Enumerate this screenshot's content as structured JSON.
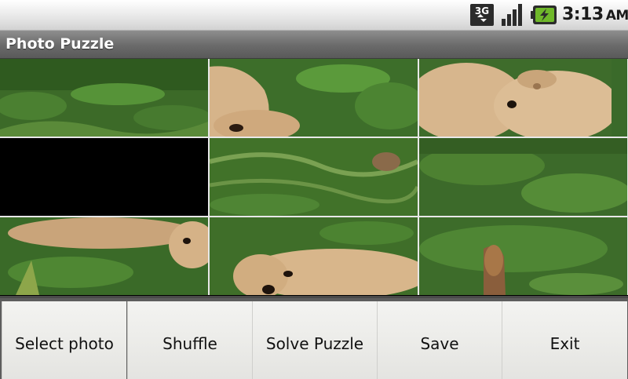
{
  "status_bar": {
    "network_icon": "3g-data-icon",
    "signal_icon": "signal-strength-icon",
    "battery_icon": "battery-charging-icon",
    "time": "3:13",
    "ampm": "AM"
  },
  "app": {
    "title": "Photo Puzzle"
  },
  "puzzle": {
    "rows": 3,
    "cols": 3,
    "empty_tile": "row 2, column 1"
  },
  "menu": {
    "items": [
      {
        "label": "Select photo"
      },
      {
        "label": "Shuffle"
      },
      {
        "label": "Solve Puzzle"
      },
      {
        "label": "Save"
      },
      {
        "label": "Exit"
      }
    ]
  },
  "colors": {
    "grass": "#3f6b2a",
    "animal": "#d9b98e",
    "titlebar": "#707070",
    "menu_bg": "#eeeeeb"
  }
}
